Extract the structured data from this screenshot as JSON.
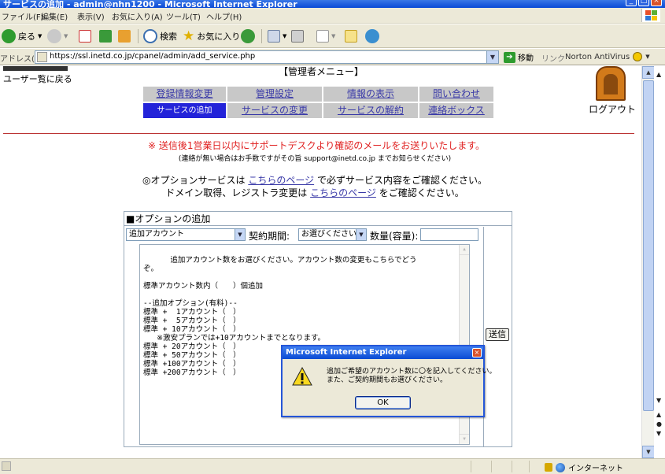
{
  "window": {
    "title": "サービスの追加 - admin@nhn1200 - Microsoft Internet Explorer",
    "controls": [
      "_",
      "□",
      "×"
    ]
  },
  "menu": [
    "ファイル(F)",
    "編集(E)",
    "表示(V)",
    "お気に入り(A)",
    "ツール(T)",
    "ヘルプ(H)"
  ],
  "toolbar": {
    "back_label": "戻る",
    "search_label": "検索",
    "favorites_label": "お気に入り"
  },
  "address": {
    "label": "アドレス(D)",
    "url": "https://ssl.inetd.co.jp/cpanel/admin/add_service.php",
    "go_label": "移動",
    "links_label": "リンク",
    "norton_label": "Norton AntiVirus"
  },
  "page": {
    "user_back": "ユーザー覧に戻る",
    "admin_menu": "【管理者メニュー】",
    "logout": "ログアウト",
    "nav_row1": [
      "登録情報変更",
      "管理設定",
      "情報の表示",
      "問い合わせ"
    ],
    "nav_row2": [
      "サービスの追加",
      "サービスの変更",
      "サービスの解約",
      "連絡ボックス"
    ],
    "notice": "※ 送信後1営業日以内にサポートデスクより確認のメールをお送りいたします。",
    "notice_sub": "(連絡が無い場合はお手数ですがその旨 support@inetd.co.jp までお知らせください)",
    "option_line_prefix": "◎オプションサービスは",
    "option_line_link": "こちらのページ",
    "option_line_suffix": "で必ずサービス内容をご確認ください。",
    "domain_line_prefix": "ドメイン取得、レジストラ変更は",
    "domain_line_link": "こちらのページ",
    "domain_line_suffix": "をご確認ください。"
  },
  "option_form": {
    "header": "■オプションの追加",
    "item_select": "追加アカウント",
    "period_label": "契約期間:",
    "period_select": "お選びください",
    "qty_label": "数量(容量):",
    "qty_value": "",
    "textarea": "追加アカウント数をお選びください。アカウント数の変更もこちらでどう\nぞ。\n\n標準アカウント数内（　　）個追加\n\n--追加オプション(有料)--\n標準 +  1アカウント（　）\n標準 +  5アカウント（　）\n標準 + 10アカウント（　）\n   ※激安プランでは+10アカウントまでとなります。\n標準 + 20アカウント（　）\n標準 + 50アカウント（　）\n標準 +100アカウント（　）\n標準 +200アカウント（　）",
    "send_label": "送信"
  },
  "status": {
    "zone": "インターネット"
  },
  "dialog": {
    "title": "Microsoft Internet Explorer",
    "message_line1": "追加ご希望のアカウント数に〇を記入してください。",
    "message_line2": "また、ご契約期間もお選びください。",
    "ok_label": "OK"
  }
}
